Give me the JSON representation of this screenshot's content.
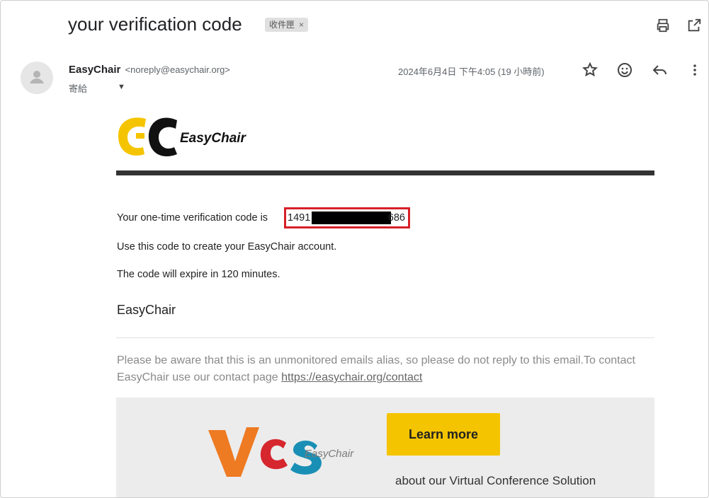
{
  "email": {
    "subject": "your verification code",
    "label": "收件匣",
    "label_close": "×",
    "sender_name": "EasyChair",
    "sender_email": "<noreply@easychair.org>",
    "to_label": "寄給",
    "date": "2024年6月4日 下午4:05 (19 小時前)"
  },
  "body": {
    "logo_text": "EasyChair",
    "code_intro": "Your one-time verification code is ",
    "code_visible_start": "1491",
    "code_visible_end": "686",
    "instruction": "Use this code to create your EasyChair account.",
    "expiry": "The code will expire in 120 minutes.",
    "signoff": "EasyChair",
    "notice_text": "Please be aware that this is an unmonitored emails alias, so please do not reply to this email.To contact EasyChair use our contact page ",
    "contact_link": "https://easychair.org/contact"
  },
  "promo": {
    "logo_text": "EasyChair",
    "button_label": "Learn more",
    "caption": "about our Virtual Conference Solution"
  },
  "icons": [
    "print-icon",
    "open-new-window-icon",
    "star-icon",
    "emoji-icon",
    "reply-icon",
    "more-icon",
    "avatar-icon",
    "chevron-down-icon"
  ],
  "colors": {
    "highlight_box": "#d62027",
    "button": "#f5c400",
    "logo_yellow": "#f5c400"
  }
}
